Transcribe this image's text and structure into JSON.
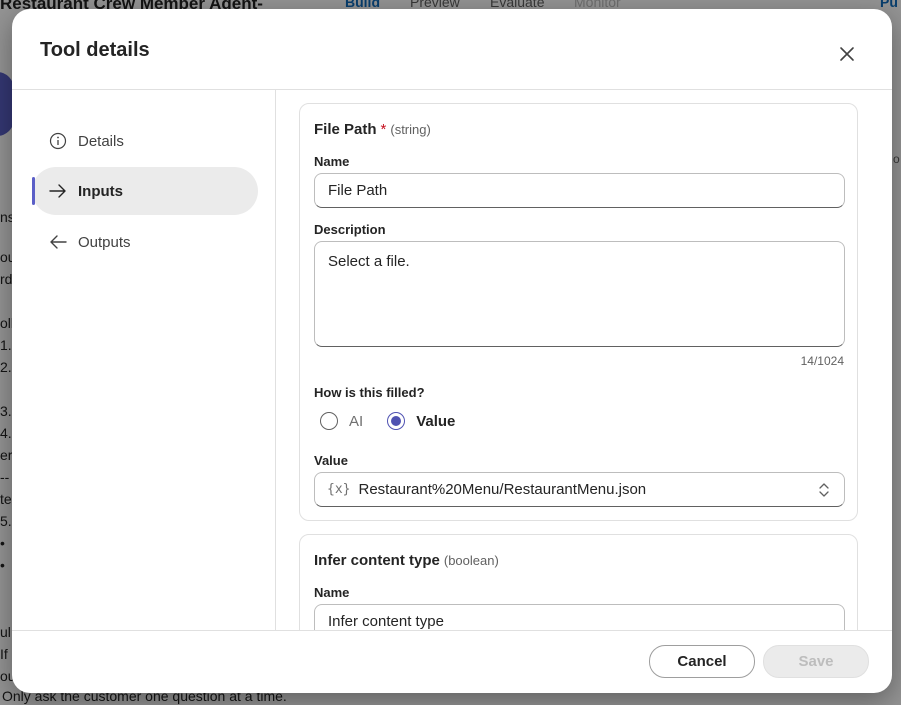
{
  "background": {
    "app_title": "Restaurant Crew Member Agent-",
    "tabs": [
      "Build",
      "Preview",
      "Evaluate",
      "Monitor"
    ],
    "publish_label": "Pu",
    "side_lines": [
      "nst",
      "ou",
      "rd",
      "oll",
      "1.",
      "2.",
      "3.",
      "4.",
      "er",
      "--",
      "te",
      "5.",
      "•",
      "•",
      "ul",
      "If",
      "ou"
    ],
    "bottom_text": "Only ask the customer one question at a time.",
    "right_text": "o"
  },
  "dialog": {
    "title": "Tool details",
    "nav": [
      {
        "label": "Details",
        "icon": "info-icon"
      },
      {
        "label": "Inputs",
        "icon": "arrow-right-icon"
      },
      {
        "label": "Outputs",
        "icon": "arrow-left-icon"
      }
    ],
    "active_nav": "Inputs",
    "inputs": [
      {
        "title": "File Path",
        "required_mark": "*",
        "type": "(string)",
        "name_label": "Name",
        "name_value": "File Path",
        "description_label": "Description",
        "description_value": "Select a file.",
        "counter": "14/1024",
        "filled_label": "How is this filled?",
        "options": [
          "AI",
          "Value"
        ],
        "selected_option": "Value",
        "value_label": "Value",
        "value_prefix": "{x}",
        "value": "Restaurant%20Menu/RestaurantMenu.json"
      },
      {
        "title": "Infer content type",
        "type": "(boolean)",
        "name_label": "Name",
        "name_value": "Infer content type"
      }
    ],
    "cancel_label": "Cancel",
    "save_label": "Save"
  },
  "colors": {
    "accent": "#5b5fc7",
    "required": "#c50f1f",
    "link": "#0f6cbd"
  }
}
